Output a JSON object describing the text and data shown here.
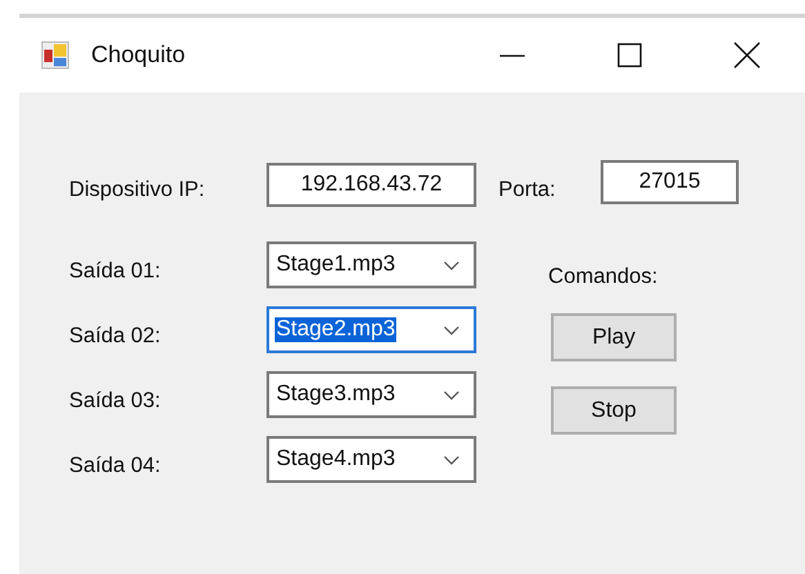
{
  "window": {
    "title": "Choquito"
  },
  "ip": {
    "label": "Dispositivo IP:",
    "value": "192.168.43.72"
  },
  "port": {
    "label": "Porta:",
    "value": "27015"
  },
  "outputs": [
    {
      "label": "Saída 01:",
      "value": "Stage1.mp3",
      "focused": false
    },
    {
      "label": "Saída 02:",
      "value": "Stage2.mp3",
      "focused": true
    },
    {
      "label": "Saída 03:",
      "value": "Stage3.mp3",
      "focused": false
    },
    {
      "label": "Saída 04:",
      "value": "Stage4.mp3",
      "focused": false
    }
  ],
  "commands": {
    "label": "Comandos:",
    "buttons": [
      "Play",
      "Stop"
    ]
  }
}
